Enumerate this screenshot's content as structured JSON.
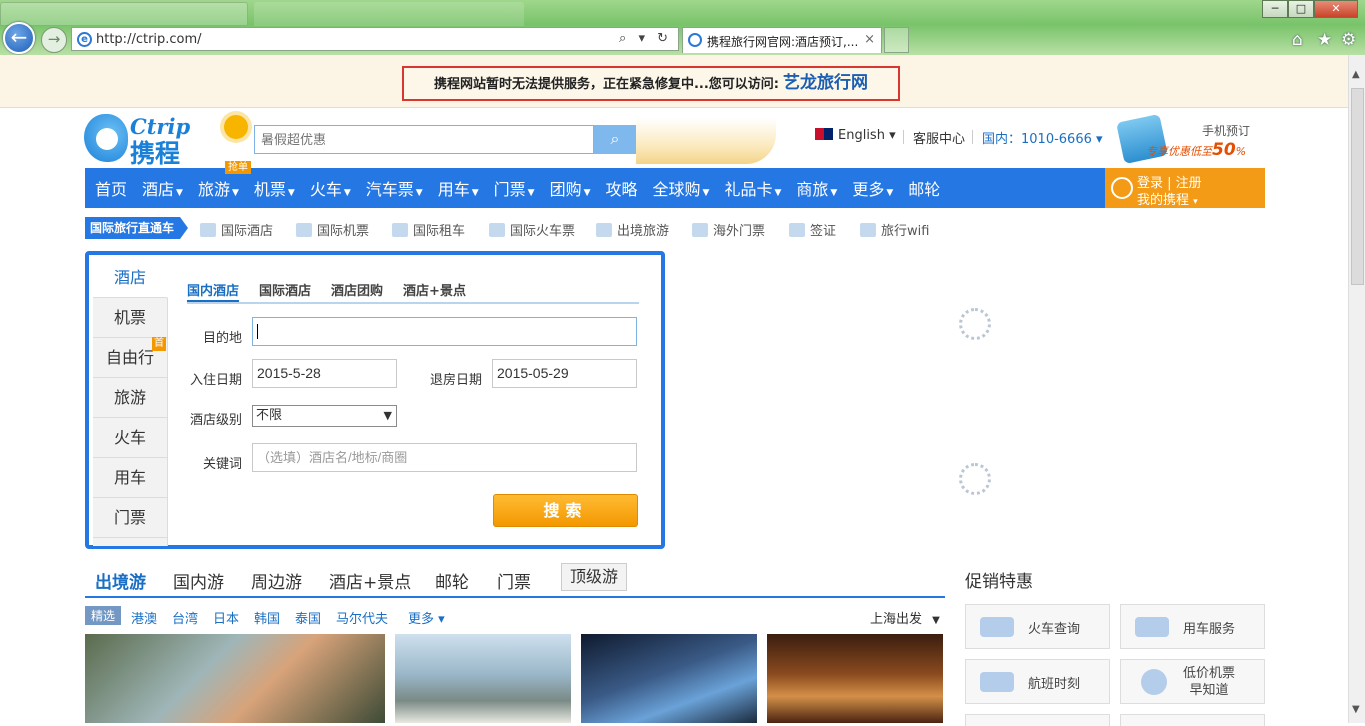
{
  "browser": {
    "url": "http://ctrip.com/",
    "tab_title": "携程旅行网官网:酒店预订,...",
    "close_tab": "×",
    "window_buttons": [
      "─",
      "□",
      "✕"
    ],
    "tools": "⌕ ▾ ↻"
  },
  "notice": {
    "text": "携程网站暂时无法提供服务，正在紧急修复中...您可以访问:",
    "link": "艺龙旅行网"
  },
  "header": {
    "logo_en": "Ctrip",
    "logo_cn": "携程",
    "search_placeholder": "暑假超优惠",
    "language": "English",
    "service_center": "客服中心",
    "hotline_label": "国内：",
    "hotline_number": "1010-6666",
    "mobile_title": "手机预订",
    "mobile_promo_prefix": "专享优惠低至",
    "mobile_promo_value": "50",
    "mobile_promo_suffix": "%"
  },
  "nav": {
    "items": [
      {
        "label": "首页",
        "dropdown": false
      },
      {
        "label": "酒店",
        "dropdown": true
      },
      {
        "label": "旅游",
        "dropdown": true
      },
      {
        "label": "机票",
        "dropdown": true
      },
      {
        "label": "火车",
        "dropdown": true
      },
      {
        "label": "汽车票",
        "dropdown": true
      },
      {
        "label": "用车",
        "dropdown": true
      },
      {
        "label": "门票",
        "dropdown": true
      },
      {
        "label": "团购",
        "dropdown": true
      },
      {
        "label": "攻略",
        "dropdown": false
      },
      {
        "label": "全球购",
        "dropdown": true
      },
      {
        "label": "礼品卡",
        "dropdown": true
      },
      {
        "label": "商旅",
        "dropdown": true
      },
      {
        "label": "更多",
        "dropdown": true
      },
      {
        "label": "邮轮",
        "dropdown": false
      }
    ],
    "badge": "抢单",
    "login": "登录",
    "register": "注册",
    "my_ctrip": "我的携程"
  },
  "quicklinks": {
    "tag": "国际旅行直通车",
    "items": [
      "国际酒店",
      "国际机票",
      "国际租车",
      "国际火车票",
      "出境旅游",
      "海外门票",
      "签证",
      "旅行wifi"
    ]
  },
  "booking": {
    "side_tabs": [
      "酒店",
      "机票",
      "自由行",
      "旅游",
      "火车",
      "用车",
      "门票"
    ],
    "side_badge": "首",
    "tabs": [
      "国内酒店",
      "国际酒店",
      "酒店团购",
      "酒店+景点"
    ],
    "dest_label": "目的地",
    "checkin_label": "入住日期",
    "checkin_value": "2015-5-28",
    "checkout_label": "退房日期",
    "checkout_value": "2015-05-29",
    "level_label": "酒店级别",
    "level_value": "不限",
    "keyword_label": "关键词",
    "keyword_placeholder": "（选填）酒店名/地标/商圈",
    "search_label": "搜索"
  },
  "vacation": {
    "tabs": [
      "出境游",
      "国内游",
      "周边游",
      "酒店+景点",
      "邮轮",
      "门票"
    ],
    "boxed_tab": "顶级游",
    "filter_active": "精选",
    "filters": [
      "港澳",
      "台湾",
      "日本",
      "韩国",
      "泰国",
      "马尔代夫"
    ],
    "more": "更多",
    "departure": "上海出发"
  },
  "promo": {
    "title": "促销特惠",
    "buttons": [
      "火车查询",
      "用车服务",
      "航班时刻",
      "低价机票\n早知道"
    ]
  }
}
